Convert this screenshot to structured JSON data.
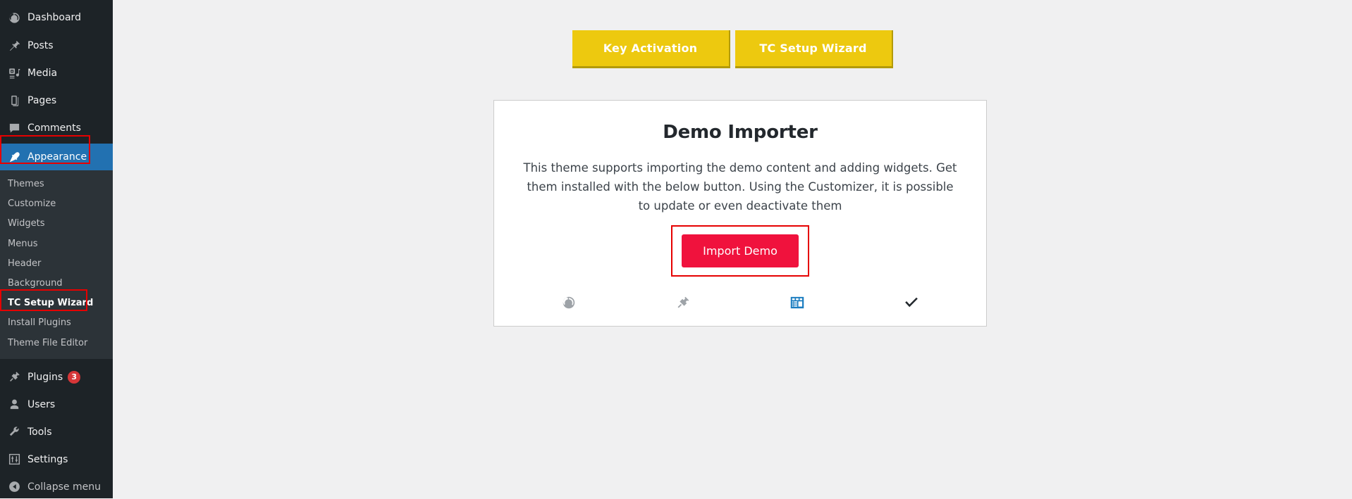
{
  "colors": {
    "sidebar_bg": "#1d2327",
    "submenu_bg": "#2c3338",
    "accent_blue": "#2271b1",
    "gold_button": "#edc90f",
    "gold_button_shadow": "#b39b0b",
    "import_red": "#f0123d",
    "highlight_outline": "#e60000",
    "page_bg": "#f0f0f1",
    "badge_red": "#d63638",
    "step_active_blue": "#1b7dc0",
    "step_inactive_gray": "#9ea3a8"
  },
  "sidebar": {
    "top_items": [
      {
        "label": "Dashboard",
        "icon": "dashboard-icon",
        "current": false
      },
      {
        "label": "Posts",
        "icon": "posts-pin-icon",
        "current": false
      },
      {
        "label": "Media",
        "icon": "media-icon",
        "current": false
      },
      {
        "label": "Pages",
        "icon": "pages-icon",
        "current": false
      },
      {
        "label": "Comments",
        "icon": "comments-icon",
        "current": false
      },
      {
        "label": "Appearance",
        "icon": "appearance-brush-icon",
        "current": true
      }
    ],
    "appearance_submenu": [
      {
        "label": "Themes",
        "current": false
      },
      {
        "label": "Customize",
        "current": false
      },
      {
        "label": "Widgets",
        "current": false
      },
      {
        "label": "Menus",
        "current": false
      },
      {
        "label": "Header",
        "current": false
      },
      {
        "label": "Background",
        "current": false
      },
      {
        "label": "TC Setup Wizard",
        "current": true
      },
      {
        "label": "Install Plugins",
        "current": false
      },
      {
        "label": "Theme File Editor",
        "current": false
      }
    ],
    "bottom_items": [
      {
        "label": "Plugins",
        "icon": "plugins-icon",
        "badge": "3"
      },
      {
        "label": "Users",
        "icon": "users-icon",
        "badge": ""
      },
      {
        "label": "Tools",
        "icon": "tools-wrench-icon",
        "badge": ""
      },
      {
        "label": "Settings",
        "icon": "settings-sliders-icon",
        "badge": ""
      }
    ],
    "collapse": {
      "label": "Collapse menu",
      "icon": "collapse-arrow-icon"
    }
  },
  "toolbar": {
    "key_activation_label": "Key Activation",
    "tc_setup_wizard_label": "TC Setup Wizard"
  },
  "card": {
    "title": "Demo Importer",
    "description": "This theme supports importing the demo content and adding widgets. Get them installed with the below button. Using the Customizer, it is possible to update or even deactivate them",
    "import_button_label": "Import Demo",
    "steps": [
      {
        "icon": "dashboard-gauge-icon",
        "state": "done"
      },
      {
        "icon": "plug-icon",
        "state": "done"
      },
      {
        "icon": "widgets-layout-icon",
        "state": "active"
      },
      {
        "icon": "checkmark-icon",
        "state": "final"
      }
    ]
  }
}
